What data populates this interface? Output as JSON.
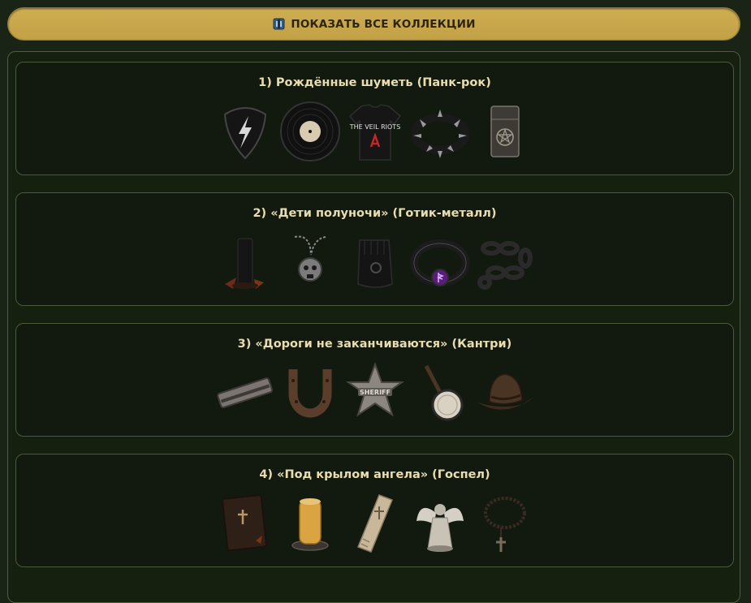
{
  "header": {
    "show_all_label": "ПОКАЗАТЬ ВСЕ КОЛЛЕКЦИИ",
    "icon": "book-collection-icon"
  },
  "collections": [
    {
      "title": "1) Рождённые шуметь (Панк-рок)",
      "items": [
        "guitar-pick-icon",
        "vinyl-record-icon",
        "band-tshirt-icon",
        "spiked-bracelet-icon",
        "zippo-lighter-icon"
      ],
      "shirt_text": "THE VEIL RIOTS"
    },
    {
      "title": "2) «Дети полуночи» (Готик-металл)",
      "items": [
        "black-candle-icon",
        "skull-pendant-icon",
        "leather-glove-icon",
        "rune-ring-icon",
        "chain-icon"
      ]
    },
    {
      "title": "3) «Дороги не заканчиваются» (Кантри)",
      "items": [
        "harmonica-icon",
        "horseshoe-icon",
        "sheriff-badge-icon",
        "banjo-icon",
        "cowboy-hat-icon"
      ],
      "badge_text": "SHERIFF"
    },
    {
      "title": "4) «Под крылом ангела» (Госпел)",
      "items": [
        "bible-icon",
        "wax-candle-icon",
        "stole-icon",
        "angel-figurine-icon",
        "rosary-icon"
      ]
    }
  ],
  "colors": {
    "accent": "#c9a84c",
    "title": "#e9ddb0",
    "card_bg": "#121a0f",
    "card_border": "#4a5a3b"
  }
}
